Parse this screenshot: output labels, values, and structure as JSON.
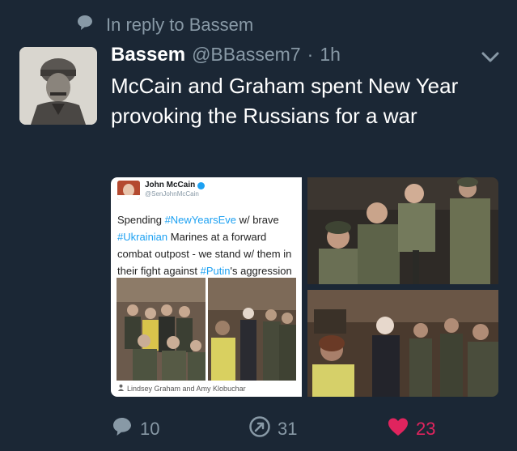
{
  "reply_context": {
    "text": "In reply to Bassem"
  },
  "tweet": {
    "name": "Bassem",
    "handle": "@BBassem7",
    "separator": "·",
    "time": "1h",
    "text": "McCain and Graham spent New Year provoking the Russians for a war"
  },
  "embed": {
    "name": "John McCain",
    "handle": "@SenJohnMcCain",
    "text_parts": {
      "p1": "Spending ",
      "h1": "#NewYearsEve",
      "p2": " w/ brave ",
      "h2": "#Ukrainian",
      "p3": " Marines at a forward combat outpost - we stand w/ them in their fight against ",
      "h3": "#Putin",
      "p4": "'s aggression"
    },
    "caption": "Lindsey Graham and Amy Klobuchar"
  },
  "actions": {
    "replies": "10",
    "retweets": "31",
    "likes": "23"
  },
  "colors": {
    "background": "#1b2735",
    "muted": "#8899a6",
    "like": "#e0245e",
    "link": "#1da1f2"
  }
}
